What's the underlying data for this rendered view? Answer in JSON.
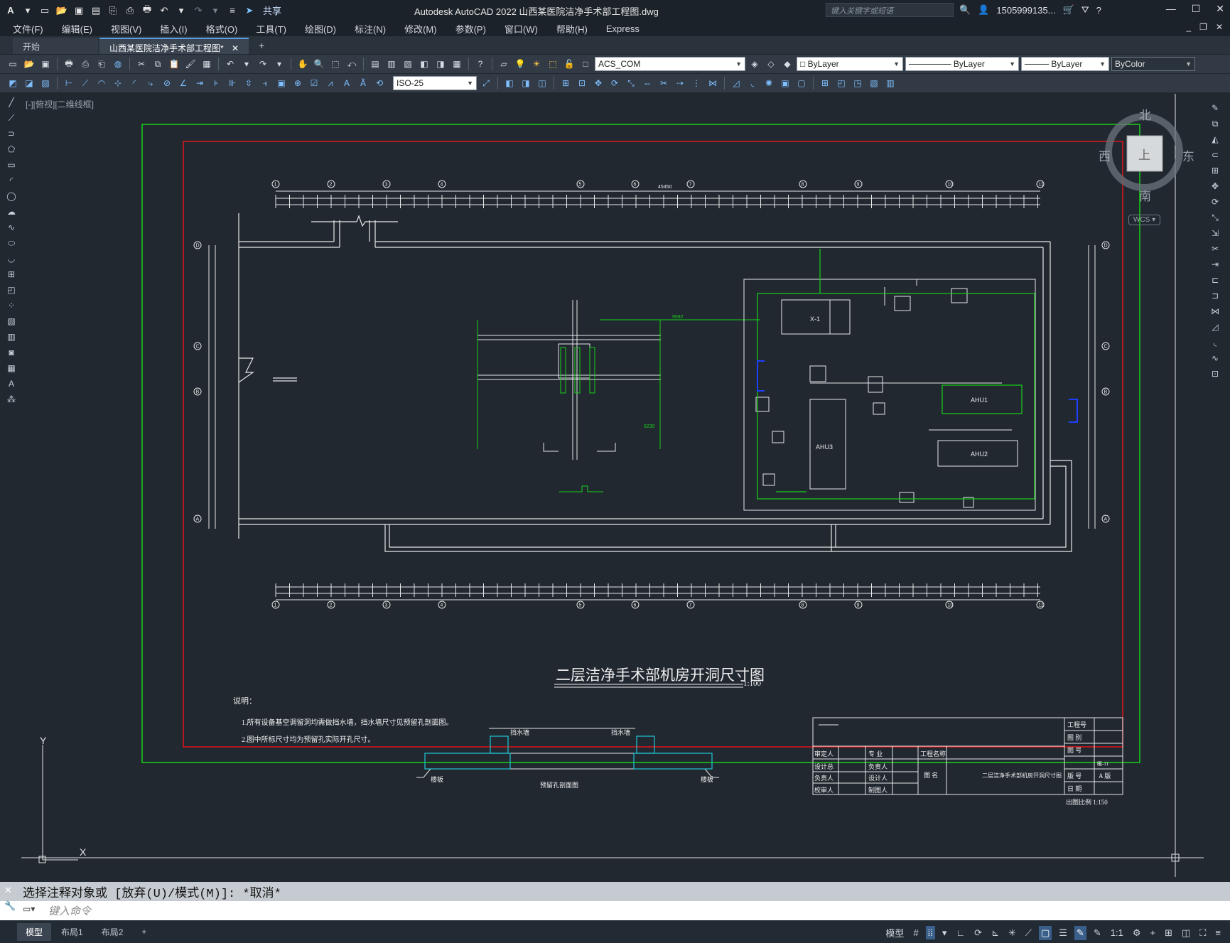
{
  "app": {
    "title": "Autodesk AutoCAD 2022    山西某医院洁净手术部工程图.dwg",
    "share_label": "共享",
    "search_placeholder": "键入关键字或短语",
    "user": "1505999135...",
    "icons": [
      "autocad-logo",
      "new-icon",
      "open-icon",
      "save-icon",
      "saveas-icon",
      "plot-icon",
      "undo-icon",
      "redo-icon"
    ]
  },
  "menu": [
    "文件(F)",
    "编辑(E)",
    "视图(V)",
    "插入(I)",
    "格式(O)",
    "工具(T)",
    "绘图(D)",
    "标注(N)",
    "修改(M)",
    "参数(P)",
    "窗口(W)",
    "帮助(H)",
    "Express"
  ],
  "tabs": {
    "start": "开始",
    "file": "山西某医院洁净手术部工程图*",
    "close": "✕",
    "add": "+"
  },
  "toolbar": {
    "layer": "ACS_COM",
    "color": "ByLayer",
    "linetype": "ByLayer",
    "lineweight": "ByLayer",
    "plotstyle": "ByColor",
    "dimstyle": "ISO-25"
  },
  "viewport_label": "[-][俯视][二维线框]",
  "viewcube": {
    "north": "北",
    "south": "南",
    "east": "东",
    "west": "西",
    "top": "上",
    "wcs": "WCS"
  },
  "drawing": {
    "title": "二层洁净手术部机房开洞尺寸图",
    "scale": "1:100",
    "notes_title": "说明：",
    "notes": [
      "1.所有设备基空调留洞均需做挡水墙，挡水墙尺寸见预留孔剖面图。",
      "2.图中所标尺寸均为预留孔实际开孔尺寸。"
    ],
    "section_label": "预留孔剖面图",
    "water_wall_left": "挡水墙",
    "water_wall_right": "挡水墙",
    "floor_left": "楼板",
    "floor_right": "楼板",
    "equipment": [
      "X-1",
      "AHU1",
      "AHU2",
      "AHU3"
    ],
    "dims": {
      "top_total": "45450",
      "dim_9592": "9592",
      "dim_6230": "6230"
    },
    "axis_top": [
      "1",
      "2",
      "3",
      "4",
      "5",
      "6",
      "7",
      "8",
      "9",
      "10",
      "11"
    ],
    "axis_side": [
      "D",
      "C",
      "B",
      "A"
    ],
    "titleblock": {
      "review": "审定人",
      "design_lead": "设计总",
      "responsible": "负责人",
      "checker": "校审人",
      "major": "专 业",
      "major_resp": "负责人",
      "designer": "设计人",
      "drafter": "制图人",
      "project_name": "工程名称",
      "drawing_name_label": "图 名",
      "drawing_name": "二层洁净手术部机房开洞尺寸图",
      "project_no": "工程号",
      "drawing_cat": "图 别",
      "drawing_no": "图 号",
      "drawing_no_val": "暖-11",
      "version_label": "版 号",
      "version": "A 版",
      "date_label": "日 期",
      "plot_scale": "出图比例  1:150"
    }
  },
  "ucs": {
    "x": "X",
    "y": "Y"
  },
  "command": {
    "history": "选择注释对象或 [放弃(U)/模式(M)]: *取消*",
    "placeholder": "键入命令"
  },
  "status": {
    "tabs": [
      "模型",
      "布局1",
      "布局2"
    ],
    "model_label": "模型",
    "scale": "1:1"
  }
}
